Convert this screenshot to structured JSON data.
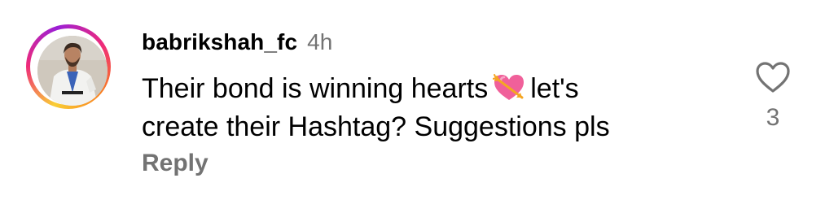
{
  "comment": {
    "username": "babrikshah_fc",
    "time": "4h",
    "text_line1_before": "Their bond is winning hearts",
    "emoji": "heart-with-arrow-icon",
    "text_line1_after": "let's",
    "text_line2": "create their Hashtag? Suggestions pls",
    "reply_label": "Reply",
    "like_count": "3"
  },
  "colors": {
    "secondary_text": "#737373",
    "story_ring": [
      "#f9ce34",
      "#ee2a7b",
      "#9b1fd6"
    ],
    "emoji_heart": "#f0609a",
    "emoji_arrow": "#f5a623"
  }
}
